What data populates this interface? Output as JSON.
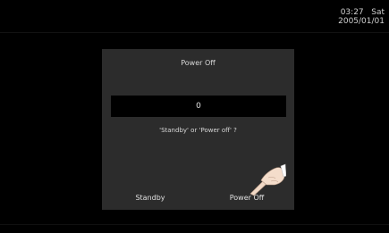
{
  "status": {
    "time": "03:27",
    "day": "Sat",
    "date": "2005/01/01"
  },
  "dialog": {
    "title": "Power Off",
    "value": "0",
    "prompt": "'Standby' or 'Power off' ?",
    "buttons": {
      "standby_label": "Standby",
      "poweroff_label": "Power Off"
    }
  },
  "icons": {
    "pointer": "pointing-hand-icon"
  }
}
